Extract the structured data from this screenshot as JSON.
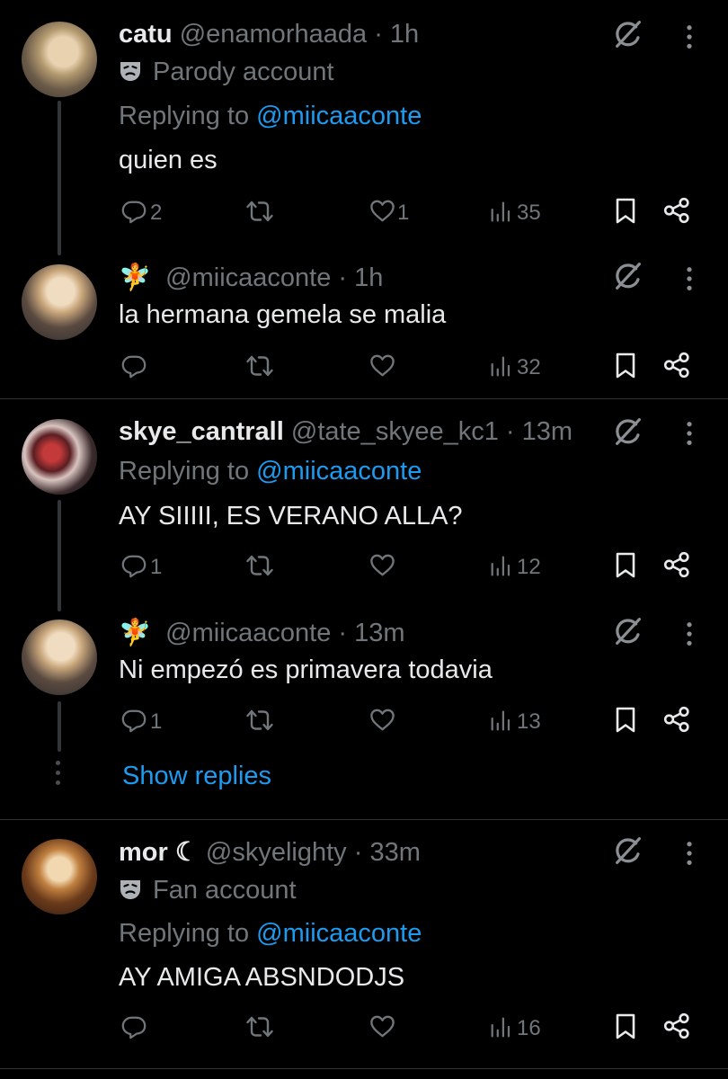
{
  "tweets": [
    {
      "name": "catu",
      "handle": "@enamorhaada",
      "time": "· 1h",
      "badge": "Parody account",
      "replying_prefix": "Replying to",
      "replying_to": "@miicaaconte",
      "text": "quien es",
      "replies": "2",
      "retweets": "",
      "likes": "1",
      "views": "35"
    },
    {
      "name_emoji": "🧚",
      "handle": "@miicaaconte",
      "time": "· 1h",
      "text": "la hermana gemela se malia",
      "replies": "",
      "retweets": "",
      "likes": "",
      "views": "32"
    },
    {
      "name": "skye_cantrall",
      "handle": "@tate_skyee_kc1",
      "time": "· 13m",
      "replying_prefix": "Replying to",
      "replying_to": "@miicaaconte",
      "text": "AY SIIIII, ES VERANO ALLA?",
      "replies": "1",
      "retweets": "",
      "likes": "",
      "views": "12"
    },
    {
      "name_emoji": "🧚",
      "handle": "@miicaaconte",
      "time": "· 13m",
      "text": "Ni empezó es primavera todavia",
      "replies": "1",
      "retweets": "",
      "likes": "",
      "views": "13"
    },
    {
      "name": "mor ☾",
      "handle": "@skyelighty",
      "time": "· 33m",
      "badge": "Fan account",
      "replying_prefix": "Replying to",
      "replying_to": "@miicaaconte",
      "text": "AY AMIGA ABSNDODJS",
      "replies": "",
      "retweets": "",
      "likes": "",
      "views": "16"
    }
  ],
  "show_replies_label": "Show replies",
  "colors": {
    "background": "#000000",
    "text": "#e7e9ea",
    "muted": "#71767b",
    "link": "#1d9bf0",
    "divider": "#2f3336"
  },
  "icons": [
    "reply-icon",
    "retweet-icon",
    "like-icon",
    "views-icon",
    "bookmark-icon",
    "share-icon",
    "grok-icon",
    "more-icon",
    "mask-icon"
  ]
}
